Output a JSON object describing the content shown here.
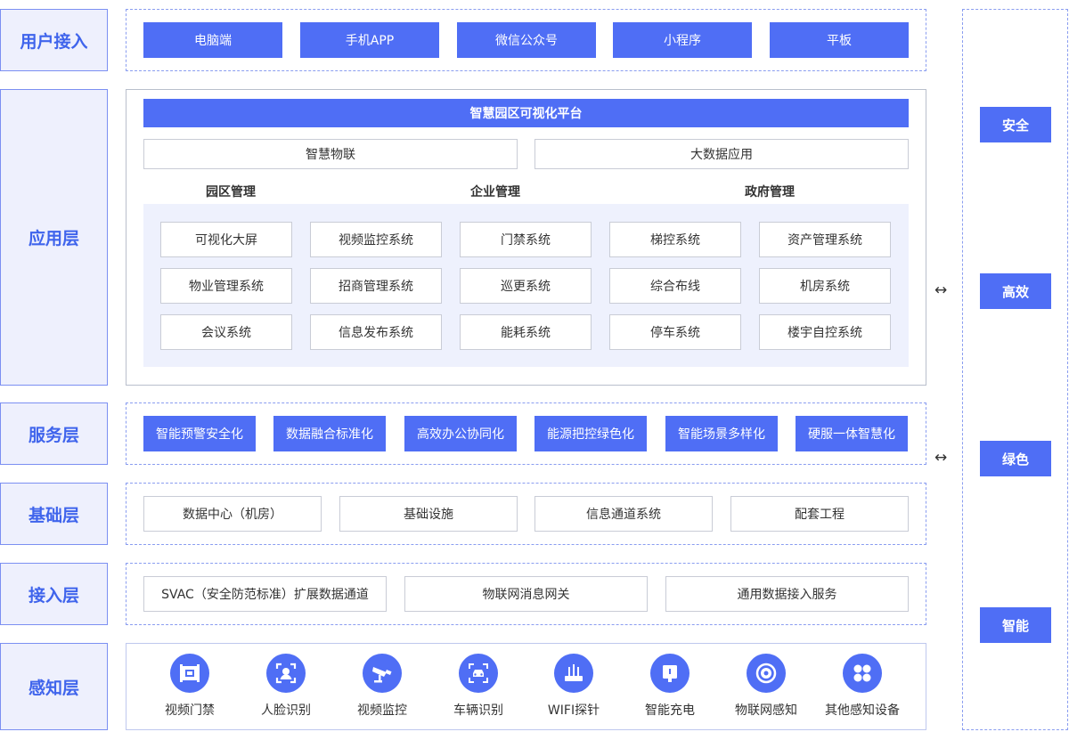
{
  "layers": {
    "user_access": "用户接入",
    "application": "应用层",
    "service": "服务层",
    "foundation": "基础层",
    "access": "接入层",
    "perception": "感知层"
  },
  "user_access_items": [
    "电脑端",
    "手机APP",
    "微信公众号",
    "小程序",
    "平板"
  ],
  "application": {
    "platform_title": "智慧园区可视化平台",
    "sub_platforms": [
      "智慧物联",
      "大数据应用"
    ],
    "sections": [
      "园区管理",
      "企业管理",
      "政府管理"
    ],
    "systems": [
      "可视化大屏",
      "视频监控系统",
      "门禁系统",
      "梯控系统",
      "资产管理系统",
      "物业管理系统",
      "招商管理系统",
      "巡更系统",
      "综合布线",
      "机房系统",
      "会议系统",
      "信息发布系统",
      "能耗系统",
      "停车系统",
      "楼宇自控系统"
    ]
  },
  "service_items": [
    "智能预警安全化",
    "数据融合标准化",
    "高效办公协同化",
    "能源把控绿色化",
    "智能场景多样化",
    "硬服一体智慧化"
  ],
  "foundation_items": [
    "数据中心（机房）",
    "基础设施",
    "信息通道系统",
    "配套工程"
  ],
  "access_items": [
    "SVAC（安全防范标准）扩展数据通道",
    "物联网消息网关",
    "通用数据接入服务"
  ],
  "perception_items": [
    {
      "label": "视频门禁",
      "icon": "door-access-icon"
    },
    {
      "label": "人脸识别",
      "icon": "face-recognition-icon"
    },
    {
      "label": "视频监控",
      "icon": "surveillance-camera-icon"
    },
    {
      "label": "车辆识别",
      "icon": "vehicle-recognition-icon"
    },
    {
      "label": "WIFI探针",
      "icon": "wifi-probe-icon"
    },
    {
      "label": "智能充电",
      "icon": "smart-charging-icon"
    },
    {
      "label": "物联网感知",
      "icon": "iot-sensor-icon"
    },
    {
      "label": "其他感知设备",
      "icon": "other-devices-icon"
    }
  ],
  "features": [
    "安全",
    "高效",
    "绿色",
    "智能"
  ],
  "connector_symbol": "↔",
  "colors": {
    "accent": "#4f6ef5",
    "label_text": "#3f64ec",
    "label_bg": "#eef0fd",
    "panel_bg": "#eef1fd"
  }
}
